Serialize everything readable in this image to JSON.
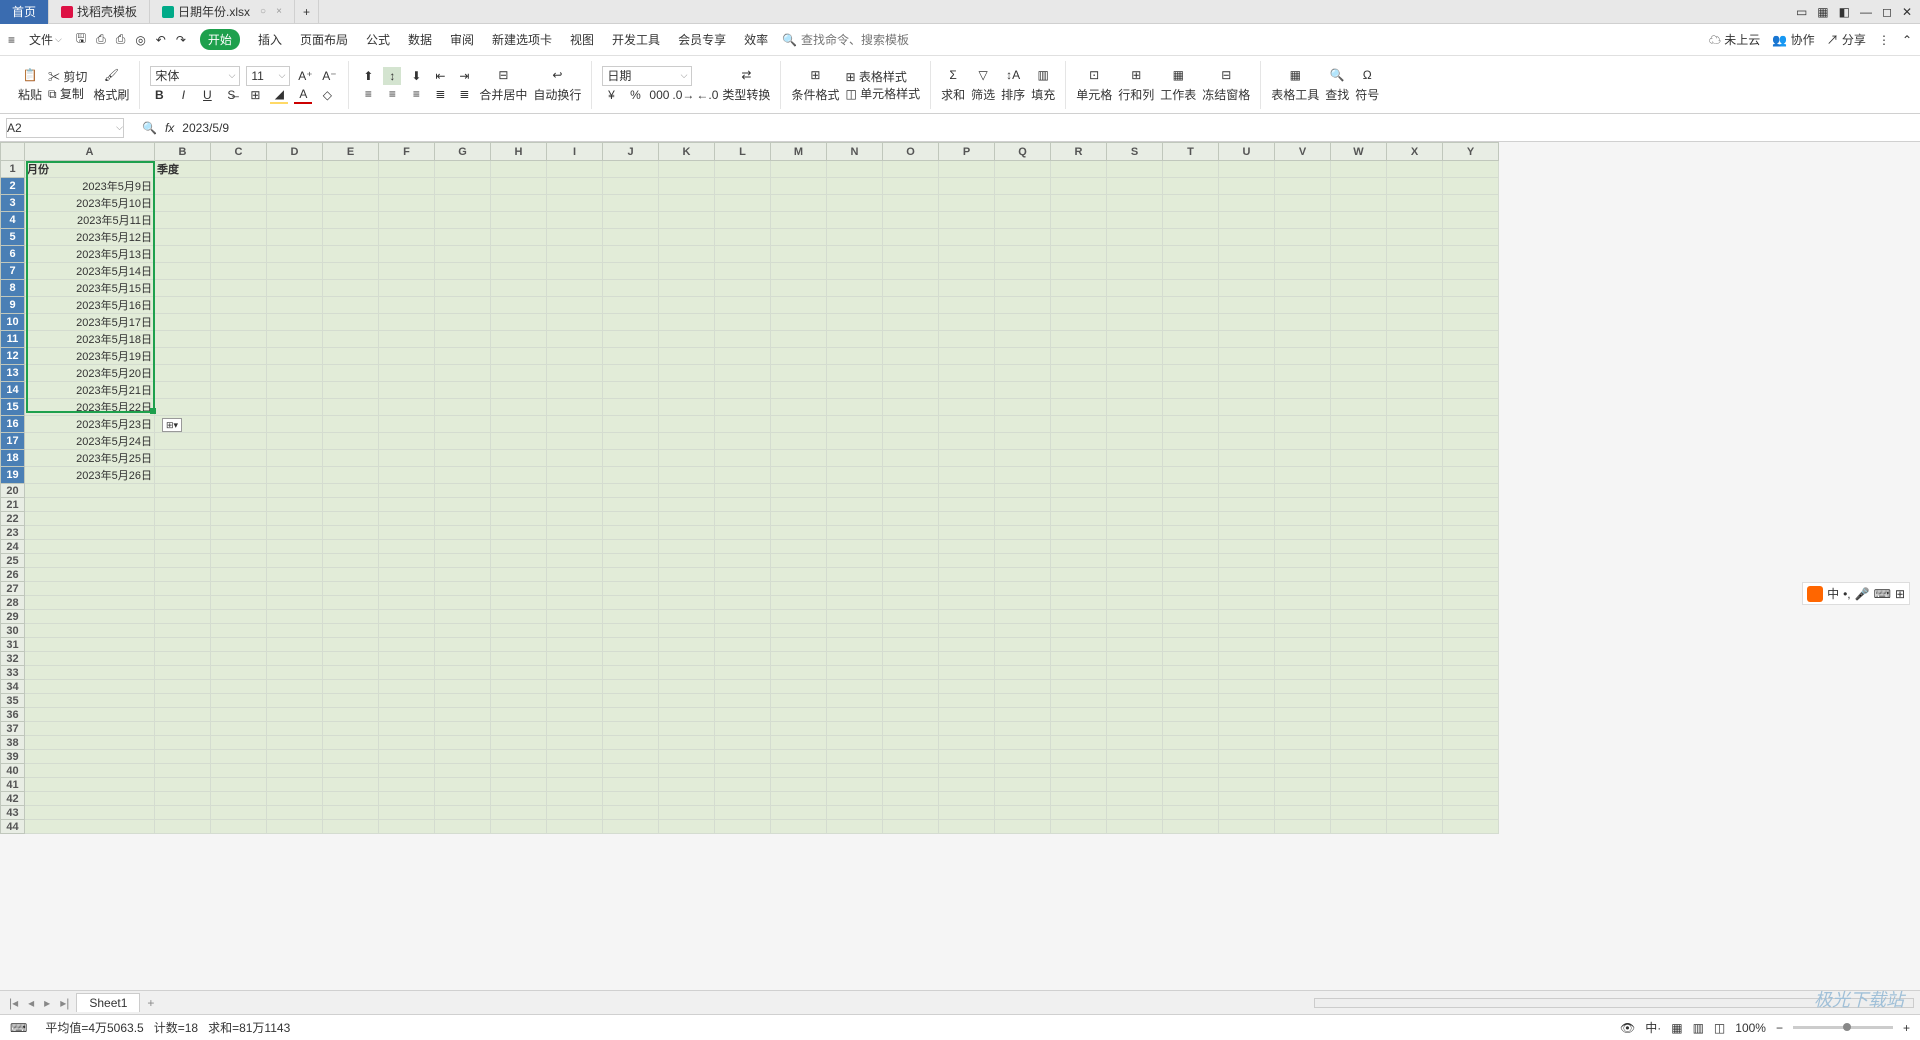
{
  "titlebar": {
    "home": "首页",
    "tab2": "找稻壳模板",
    "tab3": "日期年份.xlsx",
    "plus": "+"
  },
  "menubar": {
    "file": "文件",
    "tabs": [
      "开始",
      "插入",
      "页面布局",
      "公式",
      "数据",
      "审阅",
      "新建选项卡",
      "视图",
      "开发工具",
      "会员专享",
      "效率"
    ],
    "searchPlaceholder": "查找命令、搜索模板",
    "cloud": "未上云",
    "coop": "协作",
    "share": "分享"
  },
  "ribbon": {
    "paste": "粘贴",
    "cut": "剪切",
    "copy": "复制",
    "format": "格式刷",
    "font": "宋体",
    "size": "11",
    "merge": "合并居中",
    "wrap": "自动换行",
    "numFmt": "日期",
    "typeConv": "类型转换",
    "condFmt": "条件格式",
    "tblStyle": "表格样式",
    "cellStyle": "单元格样式",
    "sum": "求和",
    "filter": "筛选",
    "sort": "排序",
    "fill": "填充",
    "cell": "单元格",
    "rowcol": "行和列",
    "sheet": "工作表",
    "freeze": "冻结窗格",
    "tblTool": "表格工具",
    "find": "查找",
    "symbol": "符号"
  },
  "namebox": {
    "ref": "A2",
    "fx": "fx",
    "formula": "2023/5/9"
  },
  "columns": [
    "A",
    "B",
    "C",
    "D",
    "E",
    "F",
    "G",
    "H",
    "I",
    "J",
    "K",
    "L",
    "M",
    "N",
    "O",
    "P",
    "Q",
    "R",
    "S",
    "T",
    "U",
    "V",
    "W",
    "X",
    "Y"
  ],
  "rows": 44,
  "headers": {
    "A1": "月份",
    "B1": "季度"
  },
  "dataA": [
    "2023年5月9日",
    "2023年5月10日",
    "2023年5月11日",
    "2023年5月12日",
    "2023年5月13日",
    "2023年5月14日",
    "2023年5月15日",
    "2023年5月16日",
    "2023年5月17日",
    "2023年5月18日",
    "2023年5月19日",
    "2023年5月20日",
    "2023年5月21日",
    "2023年5月22日",
    "2023年5月23日",
    "2023年5月24日",
    "2023年5月25日",
    "2023年5月26日"
  ],
  "sheetTab": "Sheet1",
  "status": {
    "avg": "平均值=4万5063.5",
    "count": "计数=18",
    "sum": "求和=81万1143",
    "zoom": "100%"
  },
  "float": {
    "ime": "中"
  },
  "watermark": "极光下载站"
}
